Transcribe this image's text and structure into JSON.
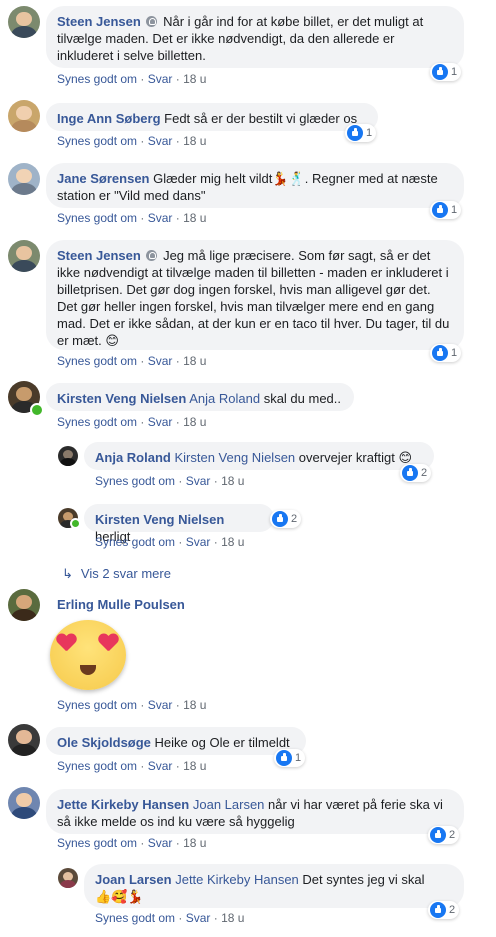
{
  "common": {
    "like_label": "Synes godt om",
    "reply_label": "Svar",
    "dot": "·"
  },
  "comments": [
    {
      "author": "Steen Jensen",
      "text": "Når i går ind for at købe billet, er det muligt at tilvælge maden. Det er ikke nødvendigt, da den allerede er inkluderet i selve billetten.",
      "time": "18 u",
      "likes": "1"
    },
    {
      "author": "Inge Ann Søberg",
      "text": "Fedt så er der bestilt vi glæder os",
      "time": "18 u",
      "likes": "1"
    },
    {
      "author": "Jane Sørensen",
      "text_before": "Glæder mig helt vildt",
      "emoji": "💃🕺",
      "text_after": ". Regner med at næste station er \"Vild med dans\"",
      "time": "18 u",
      "likes": "1"
    },
    {
      "author": "Steen Jensen",
      "text": "Jeg må lige præcisere. Som før sagt, så er det ikke nødvendigt at tilvælge maden til billetten - maden er inkluderet i billetprisen. Det gør dog ingen forskel, hvis man alligevel gør det. Det gør heller ingen forskel, hvis man tilvælger mere end en gang mad. Det er ikke sådan, at der kun er en taco til hver. Du tager, til du er mæt.",
      "emoji": "😊",
      "time": "18 u",
      "likes": "1"
    },
    {
      "author": "Kirsten Veng Nielsen",
      "tag": "Anja Roland",
      "text": "skal du med..",
      "time": "18 u"
    },
    {
      "author": "Anja Roland",
      "tag": "Kirsten Veng Nielsen",
      "text": "overvejer kraftigt",
      "emoji": "😊",
      "time": "18 u",
      "likes": "2"
    },
    {
      "author": "Kirsten Veng Nielsen",
      "text": "herligt",
      "time": "18 u",
      "likes": "2"
    },
    {
      "author": "Erling Mulle Poulsen",
      "sticker": "heart-eyes-emoji",
      "time": "18 u"
    },
    {
      "author": "Ole Skjoldsøge",
      "text": "Heike og Ole er tilmeldt",
      "time": "18 u",
      "likes": "1"
    },
    {
      "author": "Jette Kirkeby Hansen",
      "tag": "Joan Larsen",
      "text": "når vi har været på ferie ska vi så ikke melde os ind ku være så hyggelig",
      "time": "18 u",
      "likes": "2"
    },
    {
      "author": "Joan Larsen",
      "tag": "Jette Kirkeby Hansen",
      "text": "Det syntes jeg vi skal",
      "emoji": "👍🥰💃",
      "time": "18 u",
      "likes": "2"
    }
  ],
  "view_replies": "Vis 2 svar mere",
  "colors": {
    "link": "#385898",
    "bubble": "#f2f3f5",
    "like": "#1877f2",
    "meta": "#606770"
  }
}
